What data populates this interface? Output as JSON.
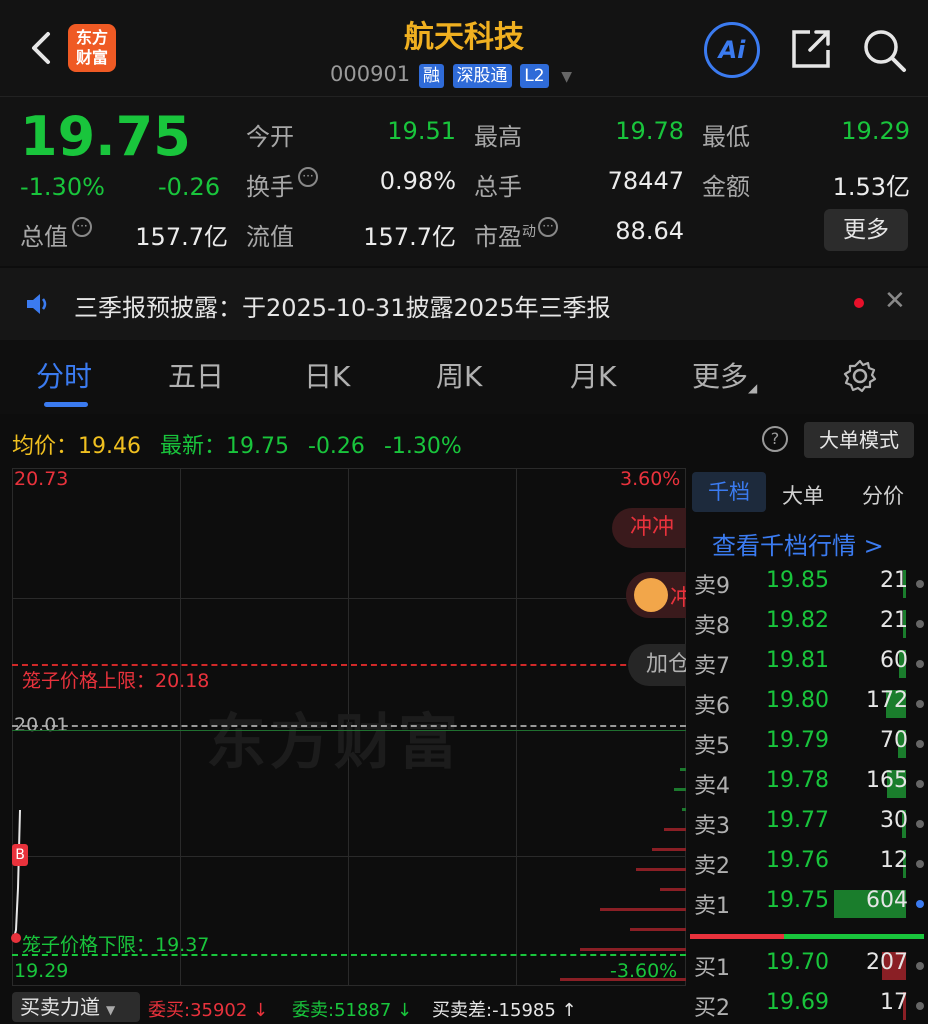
{
  "header": {
    "back_icon": "chevron-left-icon",
    "logo_text": "东方财富",
    "title": "航天科技",
    "code": "000901",
    "tags": [
      "融",
      "深股通",
      "L2"
    ],
    "ai_label": "Ai"
  },
  "quote": {
    "price": "19.75",
    "change_pct": "-1.30%",
    "change": "-0.26",
    "fields": [
      {
        "label": "今开",
        "value": "19.51"
      },
      {
        "label": "最高",
        "value": "19.78"
      },
      {
        "label": "最低",
        "value": "19.29"
      },
      {
        "label": "换手",
        "value": "0.98%"
      },
      {
        "label": "总手",
        "value": "78447"
      },
      {
        "label": "金额",
        "value": "1.53亿"
      },
      {
        "label": "总值",
        "value": "157.7亿"
      },
      {
        "label": "流值",
        "value": "157.7亿"
      },
      {
        "label": "市盈",
        "label_sup": "动",
        "value": "88.64"
      }
    ],
    "more_label": "更多"
  },
  "notice": {
    "text": "三季报预披露：于2025-10-31披露2025年三季报"
  },
  "tabs": [
    "分时",
    "五日",
    "日K",
    "周K",
    "月K",
    "更多"
  ],
  "chart_bar": {
    "avg_label": "均价：",
    "avg_value": "19.46",
    "latest_label": "最新：",
    "latest_value": "19.75",
    "latest_change": "-0.26",
    "latest_pct": "-1.30%",
    "mode_label": "大单模式"
  },
  "chart": {
    "price_top": "20.73",
    "price_bottom": "19.29",
    "pct_top": "3.60%",
    "pct_bottom": "-3.60%",
    "prev_close": "20.01",
    "upper_limit_label": "笼子价格上限：20.18",
    "lower_limit_label": "笼子价格下限：19.37",
    "watermark": "东方财富",
    "marker": "B",
    "pill_1": "冲冲",
    "pill_2": "冲",
    "pill_3": "加仓"
  },
  "orderbook": {
    "tabs": [
      "千档",
      "大单",
      "分价"
    ],
    "link": "查看千档行情 >",
    "asks": [
      {
        "label": "卖9",
        "price": "19.85",
        "vol": "21",
        "level": 0.03
      },
      {
        "label": "卖8",
        "price": "19.82",
        "vol": "21",
        "level": 0.03
      },
      {
        "label": "卖7",
        "price": "19.81",
        "vol": "60",
        "level": 0.08
      },
      {
        "label": "卖6",
        "price": "19.80",
        "vol": "172",
        "level": 0.22
      },
      {
        "label": "卖5",
        "price": "19.79",
        "vol": "70",
        "level": 0.09
      },
      {
        "label": "卖4",
        "price": "19.78",
        "vol": "165",
        "level": 0.21
      },
      {
        "label": "卖3",
        "price": "19.77",
        "vol": "30",
        "level": 0.04
      },
      {
        "label": "卖2",
        "price": "19.76",
        "vol": "12",
        "level": 0.02
      },
      {
        "label": "卖1",
        "price": "19.75",
        "vol": "604",
        "level": 0.8
      }
    ],
    "bids": [
      {
        "label": "买1",
        "price": "19.70",
        "vol": "207",
        "level": 0.27
      },
      {
        "label": "买2",
        "price": "19.69",
        "vol": "17",
        "level": 0.02
      }
    ]
  },
  "footer": {
    "dropdown": "买卖力道",
    "buy": "委买:35902 ↓",
    "sell": "委卖:51887 ↓",
    "diff": "买卖差:-15985 ↑"
  }
}
